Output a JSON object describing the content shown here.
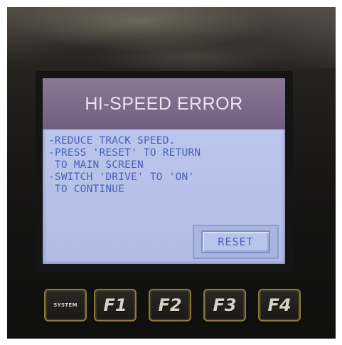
{
  "screen": {
    "title": "HI-SPEED ERROR",
    "messages": [
      "-REDUCE TRACK SPEED.",
      "-PRESS 'RESET' TO RETURN",
      " TO MAIN SCREEN",
      "-SWITCH 'DRIVE' TO 'ON'",
      " TO CONTINUE"
    ],
    "reset_label": "RESET"
  },
  "function_keys": [
    {
      "label": "SYSTEM"
    },
    {
      "label": "F1"
    },
    {
      "label": "F2"
    },
    {
      "label": "F3"
    },
    {
      "label": "F4"
    }
  ],
  "colors": {
    "title_bar": "#7c6889",
    "screen_bg": "#b9c3ea",
    "text": "#4a5fb7",
    "key_border": "#8c7a3a"
  }
}
